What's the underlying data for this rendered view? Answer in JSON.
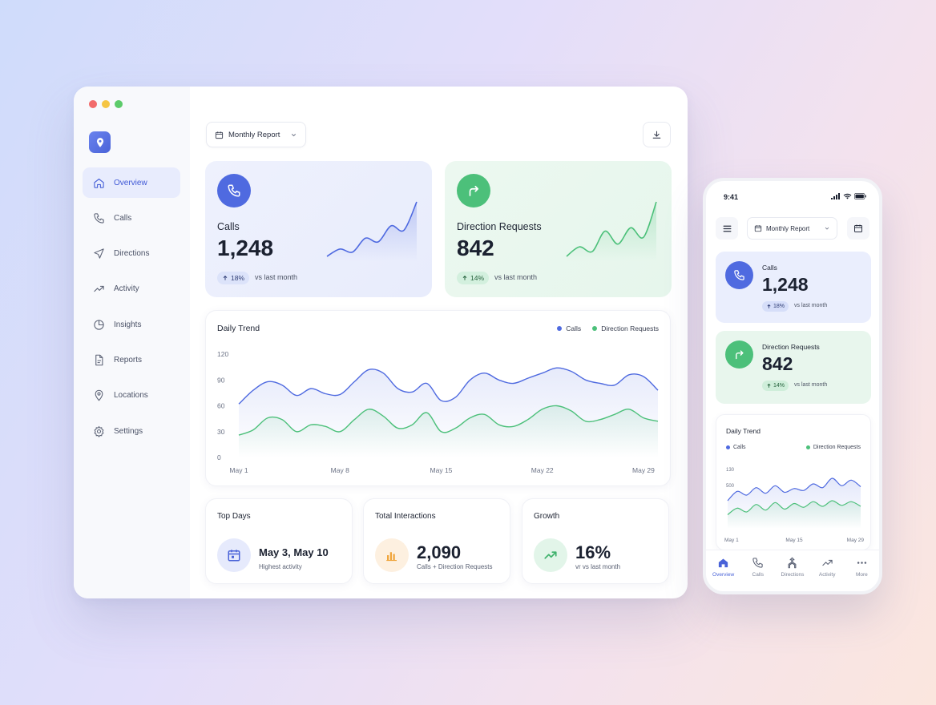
{
  "desktop": {
    "sidebar": {
      "items": [
        {
          "label": "Overview",
          "icon": "home-icon",
          "active": true
        },
        {
          "label": "Calls",
          "icon": "phone-icon"
        },
        {
          "label": "Directions",
          "icon": "navigation-icon"
        },
        {
          "label": "Activity",
          "icon": "activity-icon"
        },
        {
          "label": "Insights",
          "icon": "pie-chart-icon"
        },
        {
          "label": "Reports",
          "icon": "document-icon"
        },
        {
          "label": "Locations",
          "icon": "map-pin-icon"
        },
        {
          "label": "Settings",
          "icon": "gear-icon"
        }
      ]
    },
    "header": {
      "report_select": "Monthly Report"
    },
    "stats": {
      "calls": {
        "title": "Calls",
        "value": "1,248",
        "change": "18%",
        "note": "vs last month",
        "spark": [
          2,
          3,
          2.6,
          4.5,
          4,
          6.2,
          5.6,
          9.5
        ]
      },
      "directions": {
        "title": "Direction Requests",
        "value": "842",
        "change": "14%",
        "note": "vs last month",
        "spark": [
          2,
          3.4,
          2.7,
          5.7,
          3.8,
          6.2,
          4.8,
          10
        ]
      }
    },
    "daily_trend": {
      "title": "Daily Trend",
      "legend": [
        "Calls",
        "Direction Requests"
      ]
    },
    "cards": {
      "top_days": {
        "title": "Top Days",
        "value": "May 3, May 10",
        "sub": "Highest activity"
      },
      "total": {
        "title": "Total Interactions",
        "value": "2,090",
        "sub": "Calls + Direction Requests"
      },
      "growth": {
        "title": "Growth",
        "value": "16%",
        "sub": "vr vs last month"
      }
    }
  },
  "mobile": {
    "time": "9:41",
    "report_select": "Monthly Report",
    "calls": {
      "title": "Calls",
      "value": "1,248",
      "change": "18%",
      "note": "vs last month"
    },
    "directions": {
      "title": "Direction Requests",
      "value": "842",
      "change": "14%",
      "note": "vs last month"
    },
    "trend": {
      "title": "Daily Trend",
      "legend": [
        "Calls",
        "Direction Requests"
      ],
      "y_ticks": [
        "130",
        "500"
      ],
      "x_ticks": [
        "May 1",
        "May 15",
        "May 29"
      ]
    },
    "tabs": [
      {
        "label": "Overview",
        "icon": "home-icon",
        "active": true
      },
      {
        "label": "Calls",
        "icon": "phone-icon"
      },
      {
        "label": "Directions",
        "icon": "navigation-icon"
      },
      {
        "label": "Activity",
        "icon": "activity-icon"
      },
      {
        "label": "More",
        "icon": "more-icon"
      }
    ]
  },
  "colors": {
    "calls": "#4f6ae0",
    "directions": "#4cc07a",
    "accent": "#4a63d8"
  },
  "chart_data": [
    {
      "type": "line",
      "title": "Daily Trend",
      "x": [
        "May 1",
        "May 2",
        "May 3",
        "May 4",
        "May 5",
        "May 6",
        "May 7",
        "May 8",
        "May 9",
        "May 10",
        "May 11",
        "May 12",
        "May 13",
        "May 14",
        "May 15",
        "May 16",
        "May 17",
        "May 18",
        "May 19",
        "May 20",
        "May 21",
        "May 22",
        "May 23",
        "May 24",
        "May 25",
        "May 26",
        "May 27",
        "May 28",
        "May 29",
        "May 30"
      ],
      "x_ticks": [
        "May 1",
        "May 8",
        "May 15",
        "May 22",
        "May 29"
      ],
      "y_ticks": [
        0,
        30,
        60,
        90,
        120
      ],
      "ylim": [
        0,
        120
      ],
      "legend_position": "top-right",
      "series": [
        {
          "name": "Calls",
          "color": "#4f6ae0",
          "values": [
            62,
            78,
            88,
            84,
            72,
            80,
            74,
            73,
            88,
            102,
            98,
            80,
            76,
            86,
            66,
            70,
            90,
            98,
            90,
            86,
            92,
            98,
            104,
            100,
            90,
            86,
            84,
            96,
            94,
            78
          ]
        },
        {
          "name": "Direction Requests",
          "color": "#4cc07a",
          "values": [
            26,
            32,
            46,
            44,
            30,
            38,
            36,
            30,
            44,
            56,
            48,
            34,
            38,
            52,
            30,
            34,
            46,
            50,
            38,
            36,
            44,
            56,
            60,
            54,
            42,
            44,
            50,
            56,
            46,
            42
          ]
        }
      ]
    },
    {
      "type": "line",
      "title": "Daily Trend",
      "x": [
        "May 1",
        "May 3",
        "May 5",
        "May 7",
        "May 9",
        "May 11",
        "May 13",
        "May 15",
        "May 17",
        "May 19",
        "May 21",
        "May 23",
        "May 25",
        "May 27",
        "May 29"
      ],
      "series": [
        {
          "name": "Calls",
          "color": "#4f6ae0",
          "values": [
            60,
            80,
            72,
            88,
            76,
            92,
            78,
            86,
            82,
            96,
            88,
            108,
            92,
            104,
            90
          ]
        },
        {
          "name": "Direction Requests",
          "color": "#4cc07a",
          "values": [
            30,
            44,
            36,
            52,
            40,
            56,
            42,
            54,
            46,
            58,
            48,
            60,
            50,
            58,
            48
          ]
        }
      ]
    }
  ]
}
